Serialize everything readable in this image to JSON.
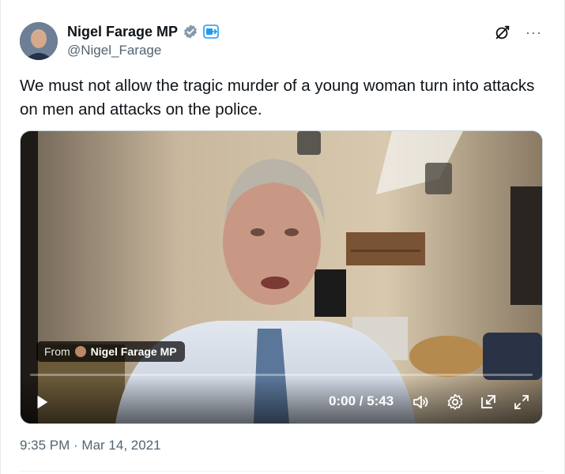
{
  "author": {
    "display_name": "Nigel Farage MP",
    "handle": "@Nigel_Farage",
    "avatar_icon": "profile-photo",
    "verified_icon": "verified-badge-icon",
    "affiliation_icon": "affiliate-badge-icon"
  },
  "actions": {
    "grok_icon": "grok-icon",
    "more_label": "···"
  },
  "tweet": {
    "text": "We must not allow the tragic murder of a young woman turn into attacks on men and attacks on the police.",
    "timestamp": "9:35 PM · Mar 14, 2021"
  },
  "video": {
    "from_label": "From",
    "from_name": "Nigel Farage MP",
    "time_display": "0:00 / 5:43",
    "progress": 0,
    "controls": [
      "play-icon",
      "volume-icon",
      "settings-icon",
      "pip-icon",
      "fullscreen-icon"
    ]
  },
  "colors": {
    "text": "#0f1419",
    "secondary": "#536471",
    "verified": "#829aab",
    "accent": "#1d9bf0"
  }
}
